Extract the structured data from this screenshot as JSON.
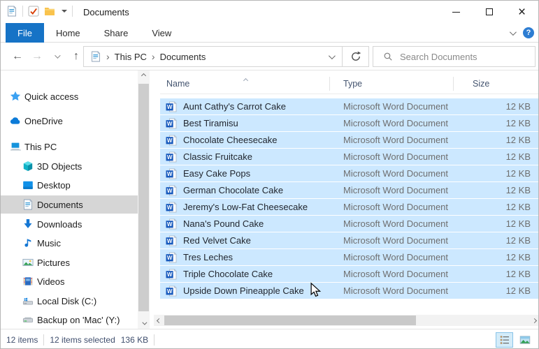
{
  "window": {
    "title": "Documents",
    "controls": {
      "close": "×"
    }
  },
  "ribbon": {
    "tabs": [
      {
        "label": "File",
        "active": true
      },
      {
        "label": "Home",
        "active": false
      },
      {
        "label": "Share",
        "active": false
      },
      {
        "label": "View",
        "active": false
      }
    ],
    "help_label": "?"
  },
  "address": {
    "breadcrumb": [
      "This PC",
      "Documents"
    ],
    "separator": "›",
    "search_placeholder": "Search Documents"
  },
  "sidebar": {
    "items": [
      {
        "label": "Quick access",
        "icon": "star-icon"
      },
      {
        "label": "OneDrive",
        "icon": "cloud-icon"
      },
      {
        "label": "This PC",
        "icon": "computer-icon"
      },
      {
        "label": "3D Objects",
        "icon": "cube-icon"
      },
      {
        "label": "Desktop",
        "icon": "desktop-icon"
      },
      {
        "label": "Documents",
        "icon": "document-icon",
        "selected": true
      },
      {
        "label": "Downloads",
        "icon": "download-arrow-icon"
      },
      {
        "label": "Music",
        "icon": "music-note-icon"
      },
      {
        "label": "Pictures",
        "icon": "picture-icon"
      },
      {
        "label": "Videos",
        "icon": "film-icon"
      },
      {
        "label": "Local Disk (C:)",
        "icon": "windows-drive-icon"
      },
      {
        "label": "Backup on 'Mac' (Y:)",
        "icon": "drive-icon"
      }
    ]
  },
  "list": {
    "columns": [
      "Name",
      "Type",
      "Size"
    ],
    "sort": {
      "column": "Name",
      "direction": "ascending"
    },
    "rows": [
      {
        "name": "Aunt Cathy's Carrot Cake",
        "type": "Microsoft Word Document",
        "size": "12 KB"
      },
      {
        "name": "Best Tiramisu",
        "type": "Microsoft Word Document",
        "size": "12 KB"
      },
      {
        "name": "Chocolate Cheesecake",
        "type": "Microsoft Word Document",
        "size": "12 KB"
      },
      {
        "name": "Classic Fruitcake",
        "type": "Microsoft Word Document",
        "size": "12 KB"
      },
      {
        "name": "Easy Cake Pops",
        "type": "Microsoft Word Document",
        "size": "12 KB"
      },
      {
        "name": "German Chocolate Cake",
        "type": "Microsoft Word Document",
        "size": "12 KB"
      },
      {
        "name": "Jeremy's Low-Fat Cheesecake",
        "type": "Microsoft Word Document",
        "size": "12 KB"
      },
      {
        "name": "Nana's Pound Cake",
        "type": "Microsoft Word Document",
        "size": "12 KB"
      },
      {
        "name": "Red Velvet Cake",
        "type": "Microsoft Word Document",
        "size": "12 KB"
      },
      {
        "name": "Tres Leches",
        "type": "Microsoft Word Document",
        "size": "12 KB"
      },
      {
        "name": "Triple Chocolate Cake",
        "type": "Microsoft Word Document",
        "size": "12 KB"
      },
      {
        "name": "Upside Down Pineapple Cake",
        "type": "Microsoft Word Document",
        "size": "12 KB"
      }
    ]
  },
  "statusbar": {
    "item_count": "12 items",
    "selection": "12 items selected",
    "selection_size": "136 KB"
  },
  "colors": {
    "accent_blue": "#1673c6",
    "selection_blue": "#cce8ff",
    "sidebar_selected": "#d6d6d6",
    "word_icon_blue": "#185abd"
  }
}
